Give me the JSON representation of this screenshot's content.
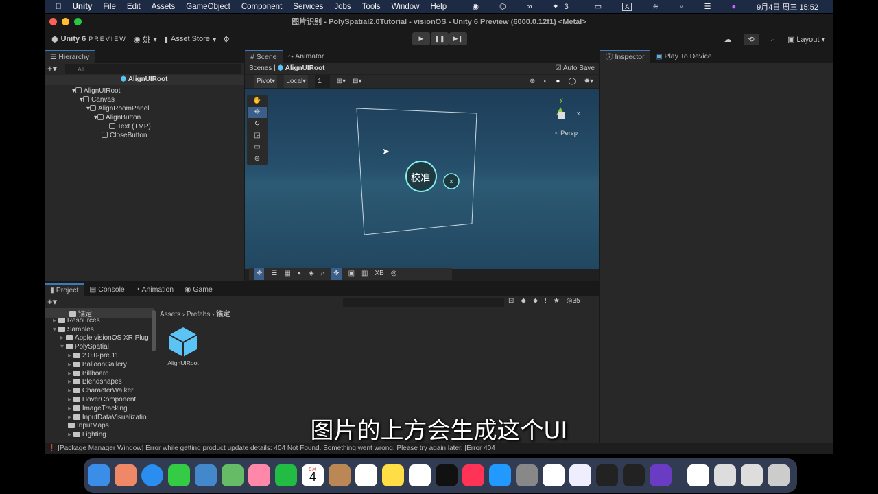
{
  "menubar": {
    "app": "Unity",
    "items": [
      "File",
      "Edit",
      "Assets",
      "GameObject",
      "Component",
      "Services",
      "Jobs",
      "Tools",
      "Window",
      "Help"
    ],
    "badge_count": "3",
    "ime": "A",
    "datetime": "9月4日 周三  15:52"
  },
  "window": {
    "title": "图片识别 - PolySpatial2.0Tutorial - visionOS - Unity 6 Preview (6000.0.12f1) <Metal>"
  },
  "toolbar": {
    "brand": "Unity 6",
    "brand_suffix": "PREVIEW",
    "account": "姚",
    "asset_store": "Asset Store",
    "layout": "Layout"
  },
  "hierarchy": {
    "tab": "Hierarchy",
    "search_placeholder": "All",
    "root": "AlignUIRoot",
    "items": [
      {
        "label": "AlignUIRoot",
        "depth": 0
      },
      {
        "label": "Canvas",
        "depth": 1
      },
      {
        "label": "AlignRoomPanel",
        "depth": 2
      },
      {
        "label": "AlignButton",
        "depth": 3
      },
      {
        "label": "Text (TMP)",
        "depth": 4
      },
      {
        "label": "CloseButton",
        "depth": 3
      }
    ]
  },
  "scene": {
    "tabs": [
      "Scene",
      "Animator"
    ],
    "breadcrumb": [
      "Scenes",
      "AlignUIRoot"
    ],
    "auto_save": "Auto Save",
    "pivot": "Pivot",
    "local": "Local",
    "grid_value": "1",
    "persp": "< Persp",
    "button_text": "校准",
    "bottom_tool": "XB",
    "gizmo_axes": [
      "y",
      "x"
    ]
  },
  "inspector": {
    "tabs": [
      "Inspector",
      "Play To Device"
    ]
  },
  "project": {
    "tabs": [
      "Project",
      "Console",
      "Animation",
      "Game"
    ],
    "count": "35",
    "breadcrumb": [
      "Assets",
      "Prefabs",
      "锚定"
    ],
    "tree": [
      {
        "label": "锚定",
        "depth": 2
      },
      {
        "label": "Resources",
        "depth": 0
      },
      {
        "label": "Samples",
        "depth": 0
      },
      {
        "label": "Apple visionOS XR Plug",
        "depth": 1
      },
      {
        "label": "PolySpatial",
        "depth": 1
      },
      {
        "label": "2.0.0-pre.11",
        "depth": 2
      },
      {
        "label": "BalloonGallery",
        "depth": 2
      },
      {
        "label": "Billboard",
        "depth": 2
      },
      {
        "label": "Blendshapes",
        "depth": 2
      },
      {
        "label": "CharacterWalker",
        "depth": 2
      },
      {
        "label": "HoverComponent",
        "depth": 2
      },
      {
        "label": "ImageTracking",
        "depth": 2
      },
      {
        "label": "InputDataVisualizatio",
        "depth": 2
      },
      {
        "label": "InputMaps",
        "depth": 2
      },
      {
        "label": "Lighting",
        "depth": 2
      }
    ],
    "asset": "AlignUIRoot"
  },
  "status": {
    "message": "[Package Manager Window] Error while getting product update details: 404 Not Found. Something went wrong. Please try again later. [Error 404"
  },
  "dock": {
    "calendar_day": "4",
    "calendar_month": "9月"
  },
  "subtitle": "图片的上方会生成这个UI"
}
